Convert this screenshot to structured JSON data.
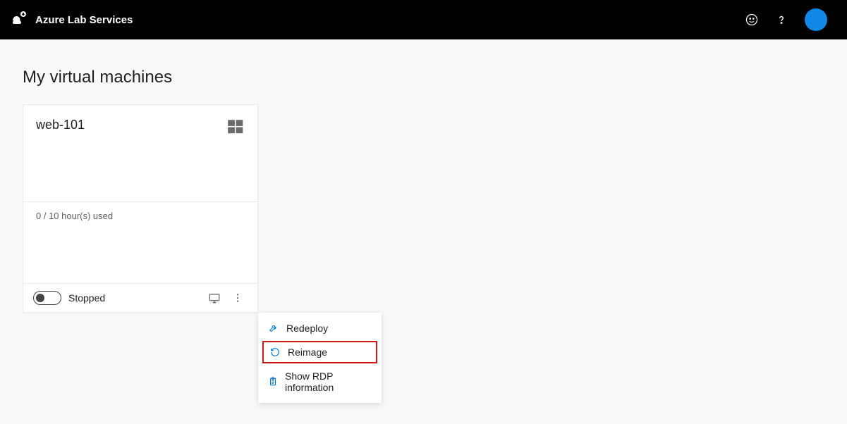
{
  "header": {
    "brand": "Azure Lab Services"
  },
  "page": {
    "title": "My virtual machines"
  },
  "vm": {
    "name": "web-101",
    "usage": "0 / 10 hour(s) used",
    "status": "Stopped"
  },
  "menu": {
    "redeploy": "Redeploy",
    "reimage": "Reimage",
    "show_rdp": "Show RDP information"
  }
}
